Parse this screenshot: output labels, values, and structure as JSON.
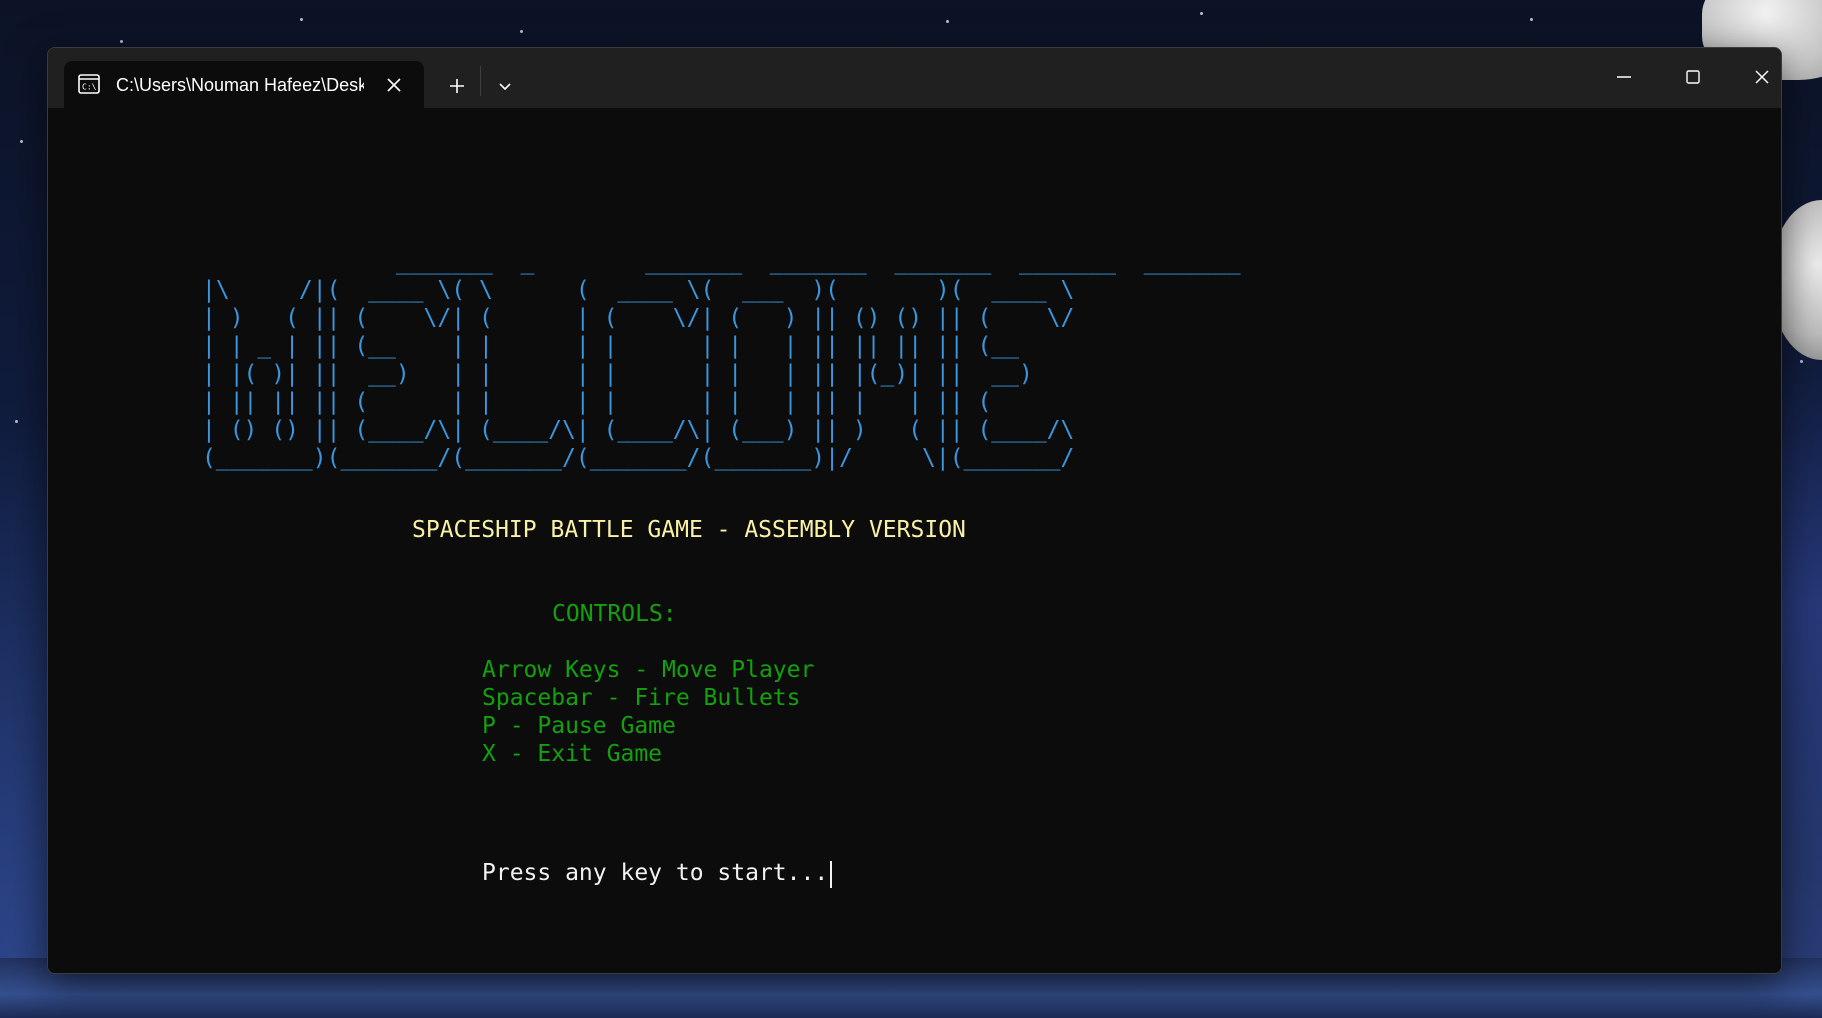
{
  "window": {
    "tab_title": "C:\\Users\\Nouman Hafeez\\Desktop",
    "tab_icon": "terminal-icon",
    "buttons": {
      "close_tab": "close-icon",
      "new_tab": "plus-icon",
      "dropdown": "chevron-down-icon",
      "minimize": "minimize-icon",
      "maximize": "maximize-icon",
      "close_window": "close-icon"
    }
  },
  "console": {
    "welcome_art": "              _______  _        _______  _______  _______  _______  _______ \n|\\     /|(  ____ \\( \\      (  ____ \\(  ___  )(       )(  ____ \\\n| )   ( || (    \\/| (      | (    \\/| (   ) || () () || (    \\/\n| | _ | || (__    | |      | |      | |   | || || || || (__    \n| |( )| ||  __)   | |      | |      | |   | || |(_)| ||  __)   \n| || || || (      | |      | |      | |   | || |   | || (      \n| () () || (____/\\| (____/\\| (____/\\| (___) || )   ( || (____/\\\n(_______)(_______/(_______/(_______/(_______)|/     \\|(_______/",
    "game_title": "SPACESHIP BATTLE GAME - ASSEMBLY VERSION",
    "controls_heading": "CONTROLS:",
    "controls": [
      "Arrow Keys - Move Player",
      "Spacebar - Fire Bullets",
      "P - Pause Game",
      "X - Exit Game"
    ],
    "prompt": "Press any key to start..."
  },
  "colors": {
    "terminal_bg": "#0c0c0c",
    "titlebar_bg": "#202020",
    "art_blue": "#3a96dd",
    "title_yellow": "#f9f1a5",
    "controls_green": "#13a10e",
    "prompt_white": "#f2f2f2"
  }
}
